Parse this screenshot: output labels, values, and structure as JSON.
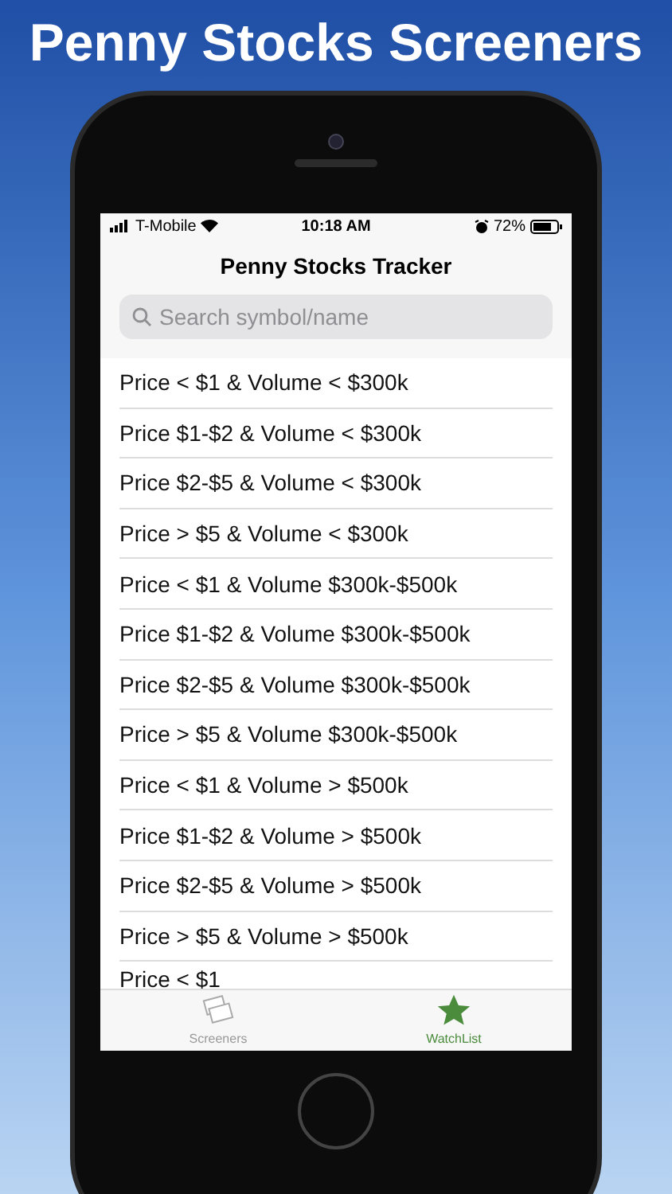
{
  "headline": "Penny Stocks Screeners",
  "status_bar": {
    "carrier": "T-Mobile",
    "time": "10:18 AM",
    "battery": "72%"
  },
  "nav": {
    "title": "Penny Stocks Tracker"
  },
  "search": {
    "placeholder": "Search symbol/name"
  },
  "screeners": [
    {
      "label": "Price < $1 & Volume < $300k"
    },
    {
      "label": "Price $1-$2 & Volume < $300k"
    },
    {
      "label": "Price $2-$5 & Volume < $300k"
    },
    {
      "label": "Price > $5 & Volume < $300k"
    },
    {
      "label": "Price < $1 & Volume $300k-$500k"
    },
    {
      "label": "Price $1-$2 & Volume $300k-$500k"
    },
    {
      "label": "Price $2-$5 & Volume $300k-$500k"
    },
    {
      "label": "Price > $5 & Volume $300k-$500k"
    },
    {
      "label": "Price < $1 & Volume > $500k"
    },
    {
      "label": "Price $1-$2 & Volume > $500k"
    },
    {
      "label": "Price $2-$5 & Volume > $500k"
    },
    {
      "label": "Price > $5 & Volume > $500k"
    },
    {
      "label": "Price < $1"
    }
  ],
  "tabs": [
    {
      "label": "Screeners",
      "kind": "cards",
      "selected": false
    },
    {
      "label": "WatchList",
      "kind": "star",
      "selected": true
    }
  ]
}
